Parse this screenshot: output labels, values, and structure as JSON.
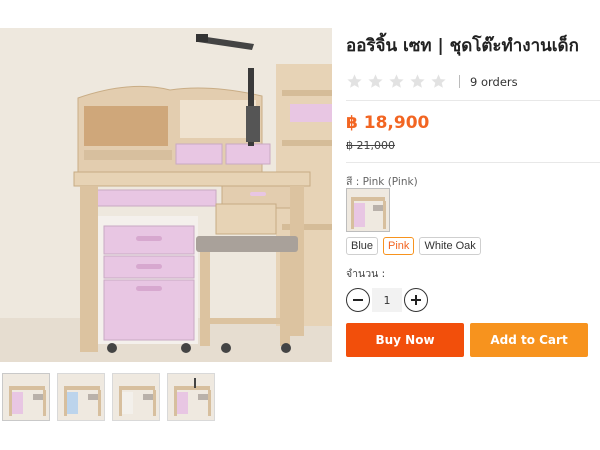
{
  "product": {
    "title": "ออริจิ้น เซท | ชุดโต๊ะทำงานเด็ก",
    "orders": "9 orders",
    "rating": {
      "filled": 0,
      "max": 5
    },
    "price": "฿ 18,900",
    "old_price": "฿ 21,000"
  },
  "color": {
    "label": "สี : Pink (Pink)",
    "options": [
      "Blue",
      "Pink",
      "White Oak"
    ],
    "selected": "Pink"
  },
  "quantity": {
    "label": "จำนวน :",
    "value": "1"
  },
  "buttons": {
    "buy_now": "Buy Now",
    "add_to_cart": "Add to Cart"
  },
  "colors": {
    "accent": "#f26522",
    "buy_now_bg": "#f24f0b",
    "add_to_cart_bg": "#f7931e",
    "cabinet_pink": "#e8c6e3",
    "wood": "#e2cdb0"
  },
  "icons": [
    "star-icon",
    "minus-icon",
    "plus-icon"
  ]
}
